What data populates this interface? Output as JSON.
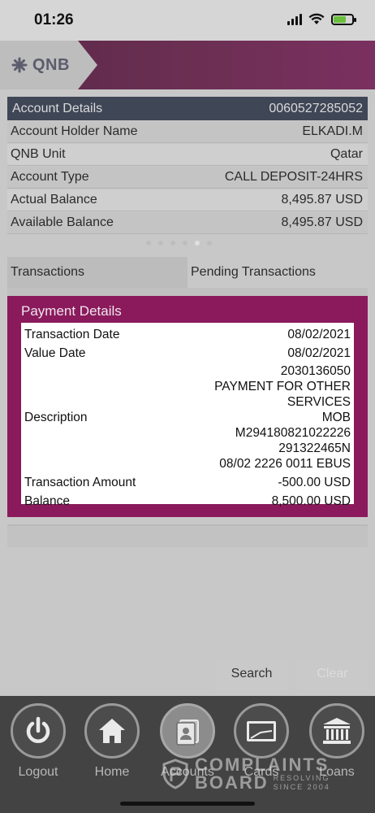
{
  "status_bar": {
    "time": "01:26"
  },
  "header": {
    "logo_text": "QNB"
  },
  "account_details": {
    "title": "Account Details",
    "account_number": "0060527285052",
    "rows": [
      {
        "label": "Account Holder Name",
        "value": "ELKADI.M"
      },
      {
        "label": "QNB Unit",
        "value": "Qatar"
      },
      {
        "label": "Account Type",
        "value": "CALL DEPOSIT-24HRS"
      },
      {
        "label": "Actual Balance",
        "value": "8,495.87 USD"
      },
      {
        "label": "Available Balance",
        "value": "8,495.87 USD"
      }
    ]
  },
  "tabs": [
    {
      "label": "Transactions",
      "active": true
    },
    {
      "label": "Pending Transactions",
      "active": false
    }
  ],
  "payment_details": {
    "title": "Payment Details",
    "transaction_date_label": "Transaction Date",
    "transaction_date": "08/02/2021",
    "value_date_label": "Value Date",
    "value_date": "08/02/2021",
    "description_label": "Description",
    "description_lines": [
      "2030136050",
      "PAYMENT FOR OTHER",
      "SERVICES",
      "MOB",
      "M294180821022226",
      "291322465N",
      "08/02 2226 0011 EBUS"
    ],
    "amount_label": "Transaction Amount",
    "amount": "-500.00 USD",
    "balance_label": "Balance",
    "balance": "8,500.00 USD"
  },
  "buttons": {
    "search": "Search",
    "clear": "Clear"
  },
  "bottom_nav": [
    {
      "label": "Logout",
      "icon": "power-icon"
    },
    {
      "label": "Home",
      "icon": "home-icon"
    },
    {
      "label": "Accounts",
      "icon": "accounts-icon",
      "active": true
    },
    {
      "label": "Cards",
      "icon": "card-icon"
    },
    {
      "label": "Loans",
      "icon": "bank-icon"
    }
  ],
  "watermark": {
    "line1": "COMPLAINTS",
    "line2": "BOARD",
    "tag1": "RESOLVING",
    "tag2": "SINCE 2004"
  },
  "colors": {
    "header_bg": "#6b2f52",
    "modal_bg": "#8a1a5c",
    "details_head_bg": "#3f4656",
    "nav_bg": "#434343"
  }
}
